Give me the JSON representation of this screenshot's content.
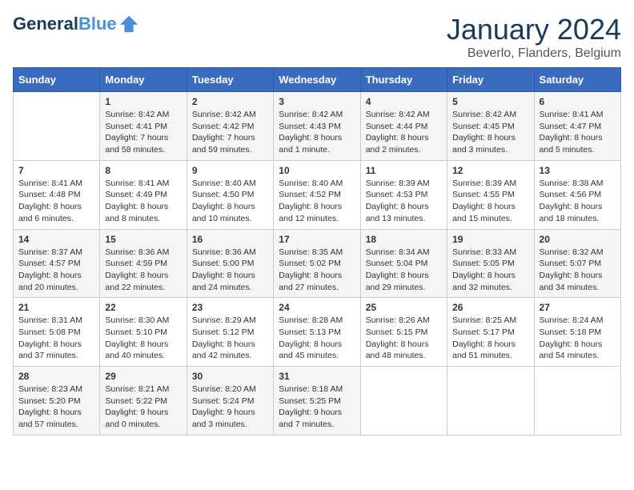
{
  "logo": {
    "line1": "General",
    "line2": "Blue"
  },
  "title": "January 2024",
  "location": "Beverlo, Flanders, Belgium",
  "headers": [
    "Sunday",
    "Monday",
    "Tuesday",
    "Wednesday",
    "Thursday",
    "Friday",
    "Saturday"
  ],
  "weeks": [
    [
      {
        "day": "",
        "sunrise": "",
        "sunset": "",
        "daylight": ""
      },
      {
        "day": "1",
        "sunrise": "Sunrise: 8:42 AM",
        "sunset": "Sunset: 4:41 PM",
        "daylight": "Daylight: 7 hours and 58 minutes."
      },
      {
        "day": "2",
        "sunrise": "Sunrise: 8:42 AM",
        "sunset": "Sunset: 4:42 PM",
        "daylight": "Daylight: 7 hours and 59 minutes."
      },
      {
        "day": "3",
        "sunrise": "Sunrise: 8:42 AM",
        "sunset": "Sunset: 4:43 PM",
        "daylight": "Daylight: 8 hours and 1 minute."
      },
      {
        "day": "4",
        "sunrise": "Sunrise: 8:42 AM",
        "sunset": "Sunset: 4:44 PM",
        "daylight": "Daylight: 8 hours and 2 minutes."
      },
      {
        "day": "5",
        "sunrise": "Sunrise: 8:42 AM",
        "sunset": "Sunset: 4:45 PM",
        "daylight": "Daylight: 8 hours and 3 minutes."
      },
      {
        "day": "6",
        "sunrise": "Sunrise: 8:41 AM",
        "sunset": "Sunset: 4:47 PM",
        "daylight": "Daylight: 8 hours and 5 minutes."
      }
    ],
    [
      {
        "day": "7",
        "sunrise": "Sunrise: 8:41 AM",
        "sunset": "Sunset: 4:48 PM",
        "daylight": "Daylight: 8 hours and 6 minutes."
      },
      {
        "day": "8",
        "sunrise": "Sunrise: 8:41 AM",
        "sunset": "Sunset: 4:49 PM",
        "daylight": "Daylight: 8 hours and 8 minutes."
      },
      {
        "day": "9",
        "sunrise": "Sunrise: 8:40 AM",
        "sunset": "Sunset: 4:50 PM",
        "daylight": "Daylight: 8 hours and 10 minutes."
      },
      {
        "day": "10",
        "sunrise": "Sunrise: 8:40 AM",
        "sunset": "Sunset: 4:52 PM",
        "daylight": "Daylight: 8 hours and 12 minutes."
      },
      {
        "day": "11",
        "sunrise": "Sunrise: 8:39 AM",
        "sunset": "Sunset: 4:53 PM",
        "daylight": "Daylight: 8 hours and 13 minutes."
      },
      {
        "day": "12",
        "sunrise": "Sunrise: 8:39 AM",
        "sunset": "Sunset: 4:55 PM",
        "daylight": "Daylight: 8 hours and 15 minutes."
      },
      {
        "day": "13",
        "sunrise": "Sunrise: 8:38 AM",
        "sunset": "Sunset: 4:56 PM",
        "daylight": "Daylight: 8 hours and 18 minutes."
      }
    ],
    [
      {
        "day": "14",
        "sunrise": "Sunrise: 8:37 AM",
        "sunset": "Sunset: 4:57 PM",
        "daylight": "Daylight: 8 hours and 20 minutes."
      },
      {
        "day": "15",
        "sunrise": "Sunrise: 8:36 AM",
        "sunset": "Sunset: 4:59 PM",
        "daylight": "Daylight: 8 hours and 22 minutes."
      },
      {
        "day": "16",
        "sunrise": "Sunrise: 8:36 AM",
        "sunset": "Sunset: 5:00 PM",
        "daylight": "Daylight: 8 hours and 24 minutes."
      },
      {
        "day": "17",
        "sunrise": "Sunrise: 8:35 AM",
        "sunset": "Sunset: 5:02 PM",
        "daylight": "Daylight: 8 hours and 27 minutes."
      },
      {
        "day": "18",
        "sunrise": "Sunrise: 8:34 AM",
        "sunset": "Sunset: 5:04 PM",
        "daylight": "Daylight: 8 hours and 29 minutes."
      },
      {
        "day": "19",
        "sunrise": "Sunrise: 8:33 AM",
        "sunset": "Sunset: 5:05 PM",
        "daylight": "Daylight: 8 hours and 32 minutes."
      },
      {
        "day": "20",
        "sunrise": "Sunrise: 8:32 AM",
        "sunset": "Sunset: 5:07 PM",
        "daylight": "Daylight: 8 hours and 34 minutes."
      }
    ],
    [
      {
        "day": "21",
        "sunrise": "Sunrise: 8:31 AM",
        "sunset": "Sunset: 5:08 PM",
        "daylight": "Daylight: 8 hours and 37 minutes."
      },
      {
        "day": "22",
        "sunrise": "Sunrise: 8:30 AM",
        "sunset": "Sunset: 5:10 PM",
        "daylight": "Daylight: 8 hours and 40 minutes."
      },
      {
        "day": "23",
        "sunrise": "Sunrise: 8:29 AM",
        "sunset": "Sunset: 5:12 PM",
        "daylight": "Daylight: 8 hours and 42 minutes."
      },
      {
        "day": "24",
        "sunrise": "Sunrise: 8:28 AM",
        "sunset": "Sunset: 5:13 PM",
        "daylight": "Daylight: 8 hours and 45 minutes."
      },
      {
        "day": "25",
        "sunrise": "Sunrise: 8:26 AM",
        "sunset": "Sunset: 5:15 PM",
        "daylight": "Daylight: 8 hours and 48 minutes."
      },
      {
        "day": "26",
        "sunrise": "Sunrise: 8:25 AM",
        "sunset": "Sunset: 5:17 PM",
        "daylight": "Daylight: 8 hours and 51 minutes."
      },
      {
        "day": "27",
        "sunrise": "Sunrise: 8:24 AM",
        "sunset": "Sunset: 5:18 PM",
        "daylight": "Daylight: 8 hours and 54 minutes."
      }
    ],
    [
      {
        "day": "28",
        "sunrise": "Sunrise: 8:23 AM",
        "sunset": "Sunset: 5:20 PM",
        "daylight": "Daylight: 8 hours and 57 minutes."
      },
      {
        "day": "29",
        "sunrise": "Sunrise: 8:21 AM",
        "sunset": "Sunset: 5:22 PM",
        "daylight": "Daylight: 9 hours and 0 minutes."
      },
      {
        "day": "30",
        "sunrise": "Sunrise: 8:20 AM",
        "sunset": "Sunset: 5:24 PM",
        "daylight": "Daylight: 9 hours and 3 minutes."
      },
      {
        "day": "31",
        "sunrise": "Sunrise: 8:18 AM",
        "sunset": "Sunset: 5:25 PM",
        "daylight": "Daylight: 9 hours and 7 minutes."
      },
      {
        "day": "",
        "sunrise": "",
        "sunset": "",
        "daylight": ""
      },
      {
        "day": "",
        "sunrise": "",
        "sunset": "",
        "daylight": ""
      },
      {
        "day": "",
        "sunrise": "",
        "sunset": "",
        "daylight": ""
      }
    ]
  ]
}
